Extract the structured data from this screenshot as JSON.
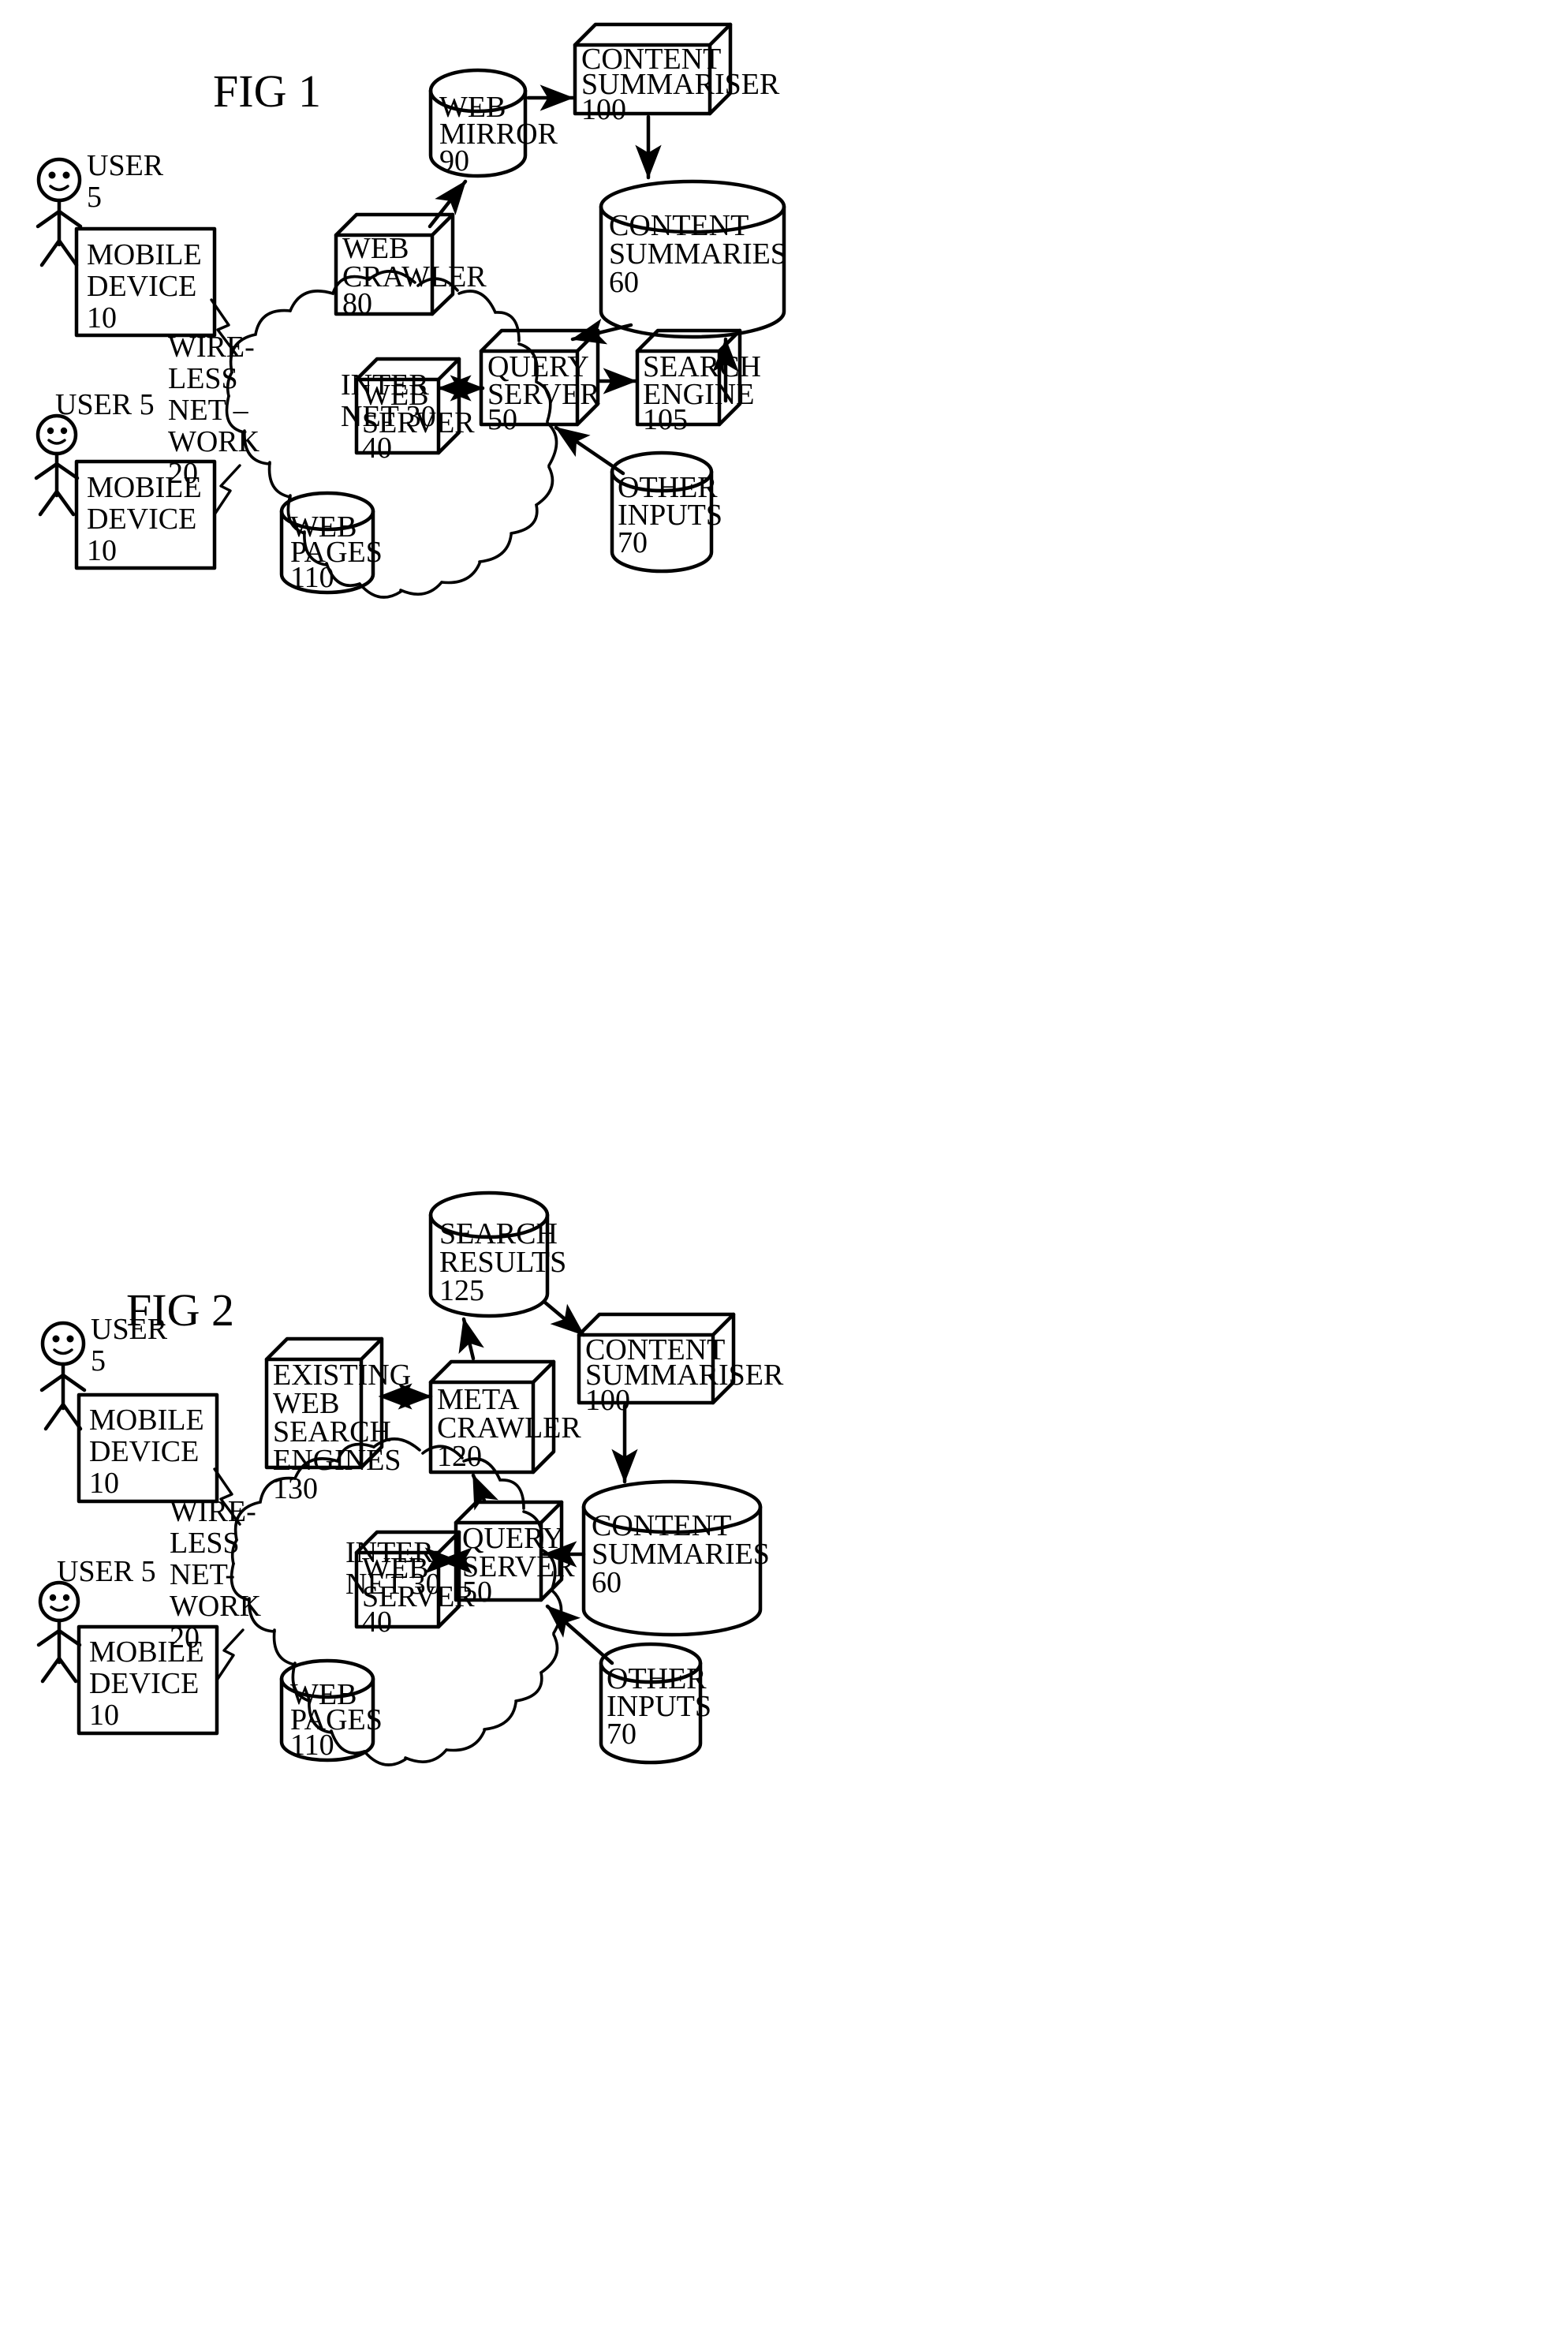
{
  "document": {
    "type": "patent-drawing-sheet",
    "figures": [
      "FIG 1",
      "FIG 2"
    ],
    "ink_color": "#000000",
    "paper_color": "#ffffff"
  },
  "fig1": {
    "title": "FIG 1",
    "nodes": {
      "user_top": {
        "label_line1": "USER",
        "label_line2": "5",
        "shape": "stick-figure"
      },
      "user_bottom": {
        "label_line1": "USER 5",
        "label_line2": "",
        "shape": "stick-figure"
      },
      "mobile_device_top": {
        "line1": "MOBILE",
        "line2": "DEVICE",
        "line3": "10",
        "shape": "rect"
      },
      "mobile_device_bottom": {
        "line1": "MOBILE",
        "line2": "DEVICE",
        "line3": "10",
        "shape": "rect"
      },
      "wireless_network": {
        "line1": "WIRE-",
        "line2": "LESS",
        "line3": "NET –",
        "line4": "WORK",
        "line5": "20",
        "shape": "text"
      },
      "internet": {
        "line1": "INTER",
        "line2": "NET 30",
        "shape": "cloud"
      },
      "web_server": {
        "line1": "WEB",
        "line2": "SERVER",
        "line3": "40",
        "shape": "box3d"
      },
      "web_pages": {
        "line1": "WEB",
        "line2": "PAGES",
        "line3": "110",
        "shape": "cylinder"
      },
      "web_crawler": {
        "line1": "WEB",
        "line2": "CRAWLER",
        "line3": "80",
        "shape": "box3d"
      },
      "web_mirror": {
        "line1": "WEB",
        "line2": "MIRROR",
        "line3": "90",
        "shape": "cylinder"
      },
      "content_summariser": {
        "line1": "CONTENT",
        "line2": "SUMMARISER",
        "line3": "100",
        "shape": "box3d"
      },
      "content_summaries": {
        "line1": "CONTENT",
        "line2": "SUMMARIES",
        "line3": "60",
        "shape": "cylinder"
      },
      "query_server": {
        "line1": "QUERY",
        "line2": "SERVER",
        "line3": "50",
        "shape": "box3d"
      },
      "search_engine": {
        "line1": "SEARCH",
        "line2": "ENGINE",
        "line3": "105",
        "shape": "box3d"
      },
      "other_inputs": {
        "line1": "OTHER",
        "line2": "INPUTS",
        "line3": "70",
        "shape": "cylinder"
      }
    },
    "connections": [
      {
        "from": "mobile_device_top",
        "to": "internet",
        "style": "lightning"
      },
      {
        "from": "mobile_device_bottom",
        "to": "internet",
        "style": "lightning"
      },
      {
        "from": "web_crawler",
        "to": "web_mirror",
        "style": "arrow"
      },
      {
        "from": "web_mirror",
        "to": "content_summariser",
        "style": "arrow"
      },
      {
        "from": "content_summariser",
        "to": "content_summaries",
        "style": "arrow"
      },
      {
        "from": "content_summaries",
        "to": "query_server",
        "style": "arrow"
      },
      {
        "from": "search_engine",
        "to": "content_summaries",
        "style": "arrow"
      },
      {
        "from": "query_server",
        "to": "search_engine",
        "style": "arrow"
      },
      {
        "from": "other_inputs",
        "to": "query_server",
        "style": "arrow"
      },
      {
        "from": "web_server",
        "to": "query_server",
        "style": "double-arrow"
      }
    ]
  },
  "fig2": {
    "title": "FIG 2",
    "nodes": {
      "user_top": {
        "label_line1": "USER",
        "label_line2": "5",
        "shape": "stick-figure"
      },
      "user_bottom": {
        "label_line1": "USER 5",
        "label_line2": "",
        "shape": "stick-figure"
      },
      "mobile_device_top": {
        "line1": "MOBILE",
        "line2": "DEVICE",
        "line3": "10",
        "shape": "rect"
      },
      "mobile_device_bottom": {
        "line1": "MOBILE",
        "line2": "DEVICE",
        "line3": "10",
        "shape": "rect"
      },
      "wireless_network": {
        "line1": "WIRE-",
        "line2": "LESS",
        "line3": "NET-",
        "line4": "WORK",
        "line5": "20",
        "shape": "text"
      },
      "internet": {
        "line1": "INTER",
        "line2": "NET 30",
        "shape": "cloud"
      },
      "web_server": {
        "line1": "WEB",
        "line2": "SERVER",
        "line3": "40",
        "shape": "box3d"
      },
      "web_pages": {
        "line1": "WEB",
        "line2": "PAGES",
        "line3": "110",
        "shape": "cylinder"
      },
      "existing_web_search_engines": {
        "line1": "EXISTING",
        "line2": "WEB",
        "line3": "SEARCH",
        "line4": "ENGINES",
        "line5": "130",
        "shape": "box3d"
      },
      "meta_crawler": {
        "line1": "META",
        "line2": "CRAWLER",
        "line3": "120",
        "shape": "box3d"
      },
      "search_results": {
        "line1": "SEARCH",
        "line2": "RESULTS",
        "line3": "125",
        "shape": "cylinder"
      },
      "content_summariser": {
        "line1": "CONTENT",
        "line2": "SUMMARISER",
        "line3": "100",
        "shape": "box3d"
      },
      "content_summaries": {
        "line1": "CONTENT",
        "line2": "SUMMARIES",
        "line3": "60",
        "shape": "cylinder"
      },
      "query_server": {
        "line1": "QUERY",
        "line2": "SERVER",
        "line3": "50",
        "shape": "box3d"
      },
      "other_inputs": {
        "line1": "OTHER",
        "line2": "INPUTS",
        "line3": "70",
        "shape": "cylinder"
      }
    },
    "connections": [
      {
        "from": "mobile_device_top",
        "to": "internet",
        "style": "lightning"
      },
      {
        "from": "mobile_device_bottom",
        "to": "internet",
        "style": "lightning"
      },
      {
        "from": "existing_web_search_engines",
        "to": "meta_crawler",
        "style": "double-arrow"
      },
      {
        "from": "meta_crawler",
        "to": "search_results",
        "style": "arrow"
      },
      {
        "from": "search_results",
        "to": "content_summariser",
        "style": "arrow"
      },
      {
        "from": "content_summariser",
        "to": "content_summaries",
        "style": "arrow"
      },
      {
        "from": "content_summaries",
        "to": "query_server",
        "style": "arrow"
      },
      {
        "from": "query_server",
        "to": "meta_crawler",
        "style": "arrow"
      },
      {
        "from": "other_inputs",
        "to": "query_server",
        "style": "arrow"
      },
      {
        "from": "web_server",
        "to": "query_server",
        "style": "double-arrow"
      }
    ]
  }
}
